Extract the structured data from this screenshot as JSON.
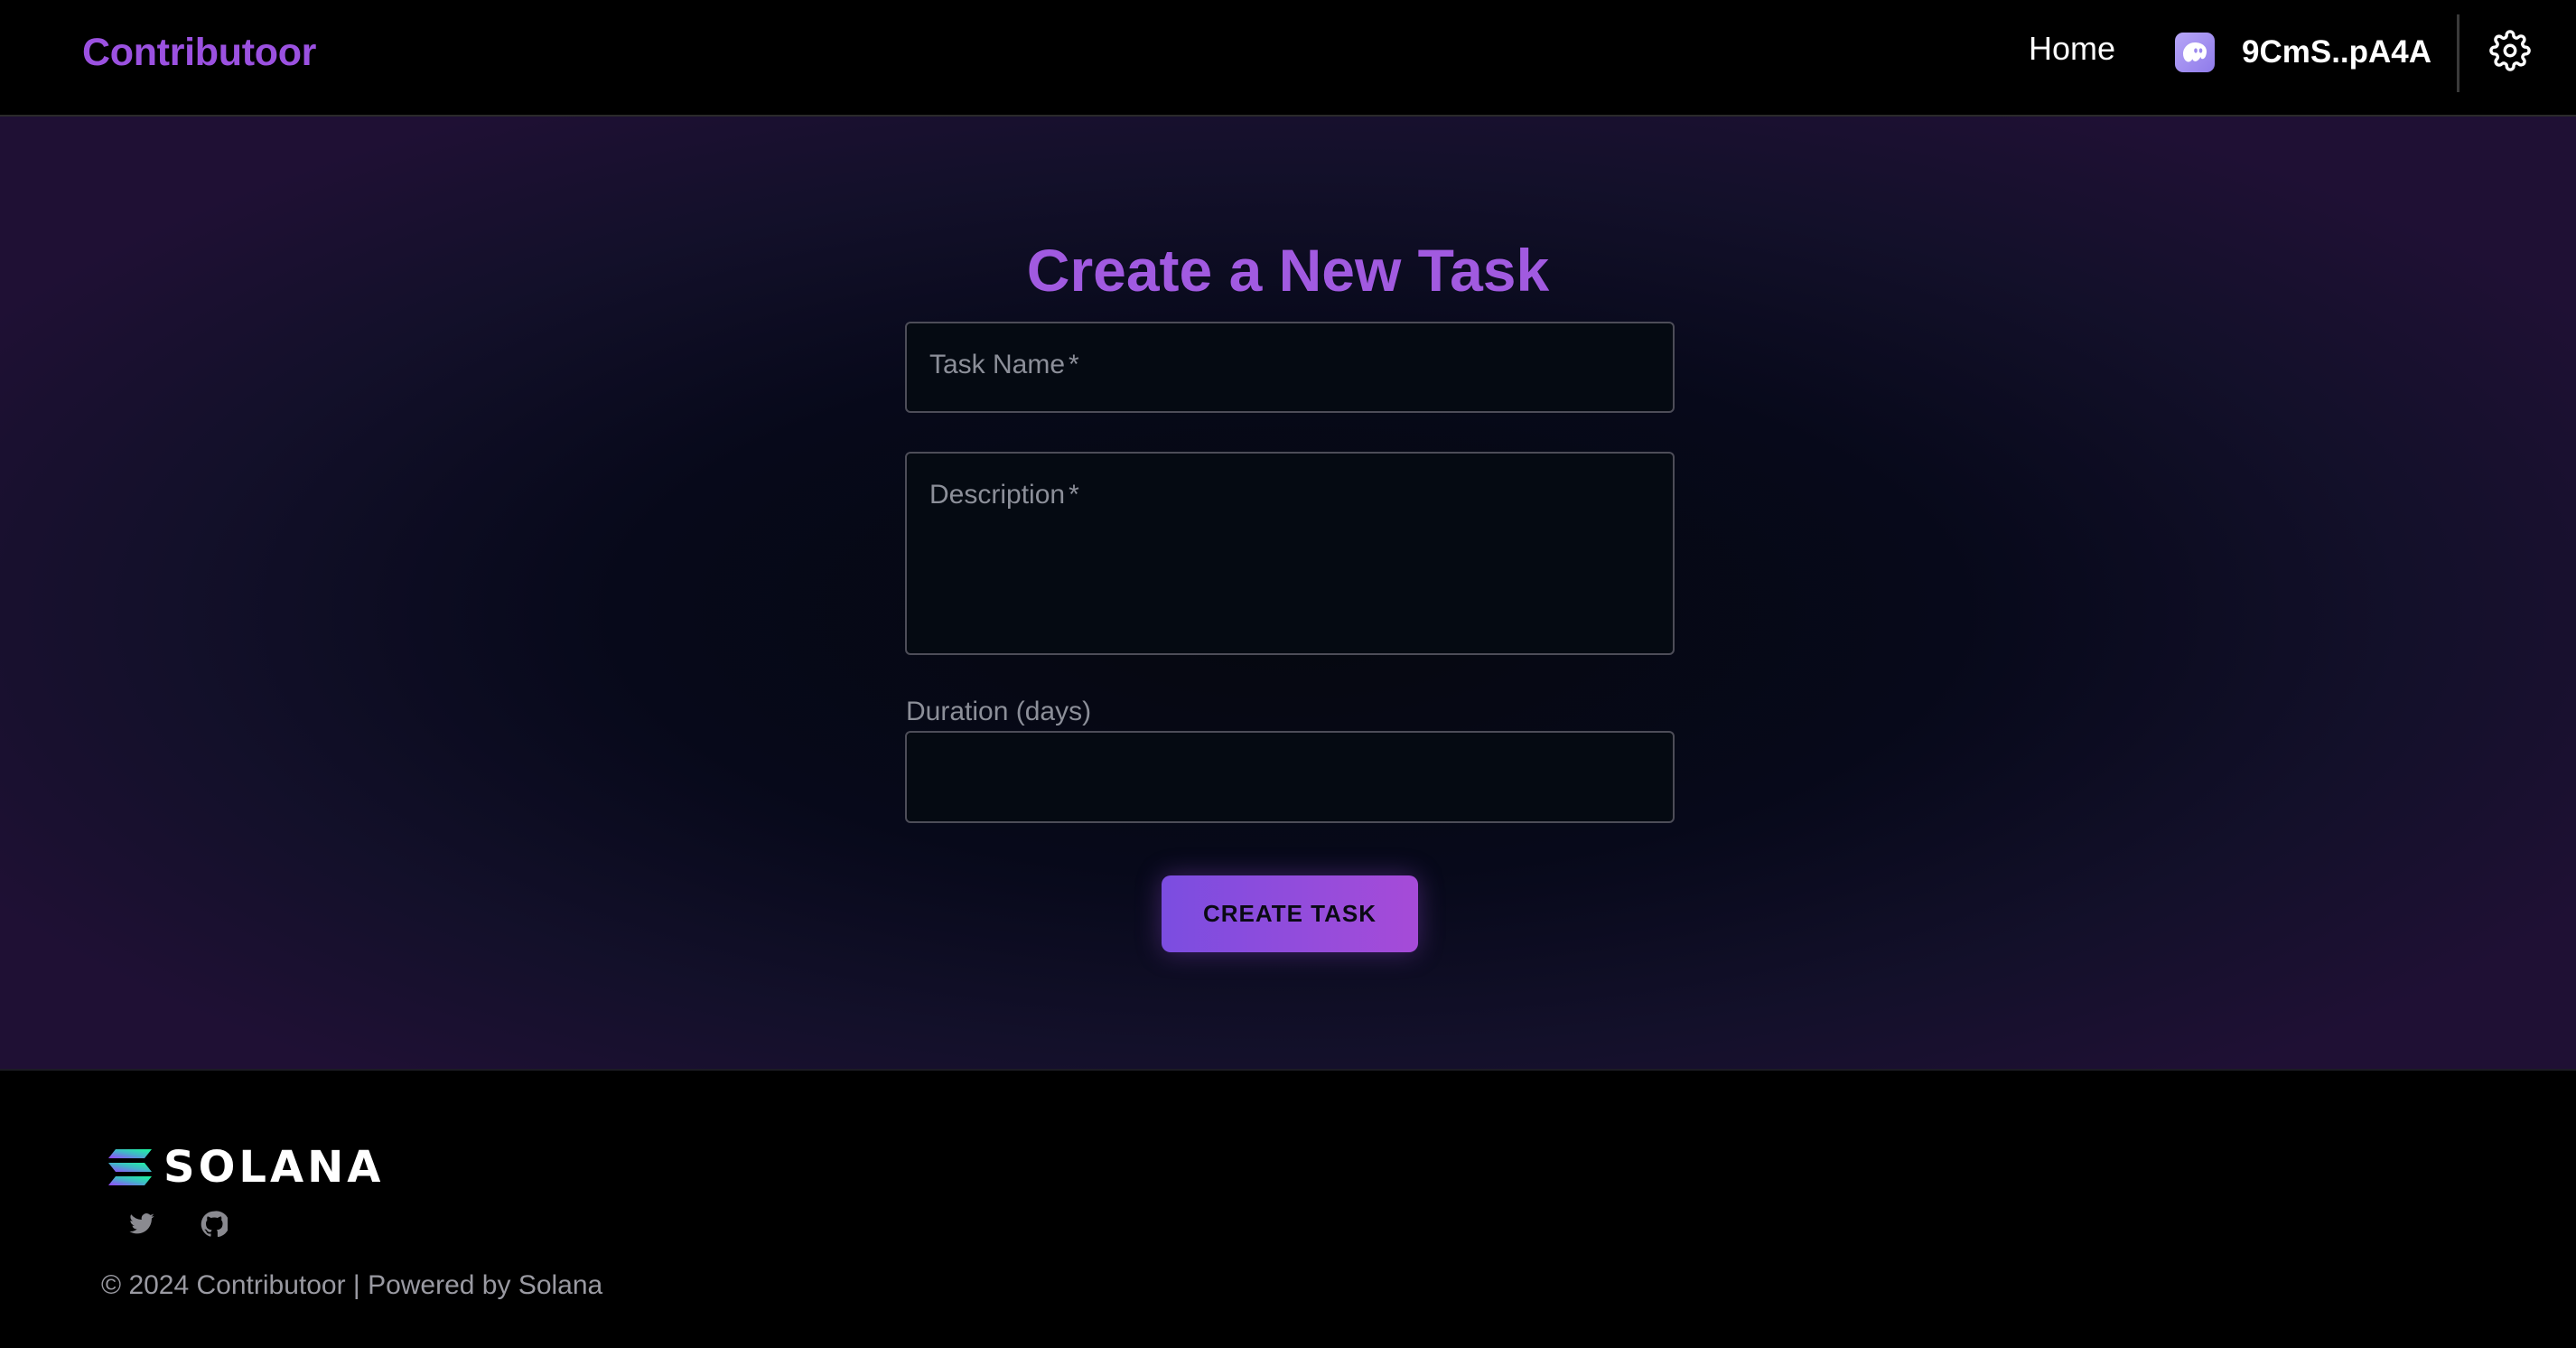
{
  "header": {
    "brand": "Contributoor",
    "nav_home": "Home",
    "wallet": {
      "address": "9CmS..pA4A",
      "icon": "phantom-ghost-icon"
    },
    "settings_icon": "gear-icon"
  },
  "form": {
    "title": "Create a New Task",
    "task_name": {
      "placeholder": "Task Name",
      "required": "*",
      "value": ""
    },
    "description": {
      "placeholder": "Description",
      "required": "*",
      "value": ""
    },
    "duration": {
      "label": "Duration (days)",
      "value": ""
    },
    "submit_label": "CREATE TASK"
  },
  "footer": {
    "logo_text": "SOLANA",
    "social": [
      "twitter-icon",
      "github-icon"
    ],
    "copyright": "© 2024 Contributoor | Powered by Solana"
  },
  "colors": {
    "brand": "#9b51e0",
    "title": "#a15ae0",
    "button_start": "#7b4de0",
    "button_end": "#a64bd8",
    "background": "#000000"
  }
}
